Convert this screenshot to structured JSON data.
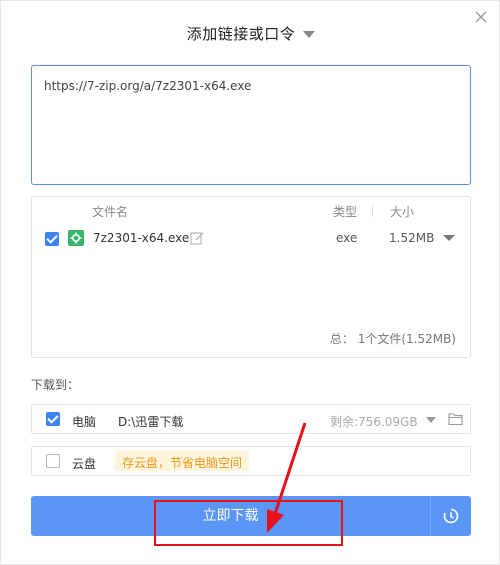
{
  "header": {
    "title": "添加链接或口令"
  },
  "url_input": {
    "value": "https://7-zip.org/a/7z2301-x64.exe"
  },
  "file_list": {
    "columns": {
      "name": "文件名",
      "type": "类型",
      "size": "大小"
    },
    "files": [
      {
        "name": "7z2301-x64.exe",
        "type": "exe",
        "size": "1.52MB",
        "checked": true
      }
    ],
    "summary": "总：  1个文件(1.52MB)"
  },
  "download_to": {
    "label": "下载到：",
    "computer": {
      "label": "电脑",
      "path": "D:\\迅雷下载",
      "free": "剩余:756.09GB",
      "checked": true
    },
    "cloud": {
      "label": "云盘",
      "tip": "存云盘，节省电脑空间",
      "checked": false
    }
  },
  "actions": {
    "download_now": "立即下载"
  },
  "colors": {
    "accent": "#5b96f7",
    "checkbox": "#3d83f7",
    "annotation": "#e8101a",
    "tip_bg": "#fff4dc",
    "tip_text": "#e79a1c"
  }
}
